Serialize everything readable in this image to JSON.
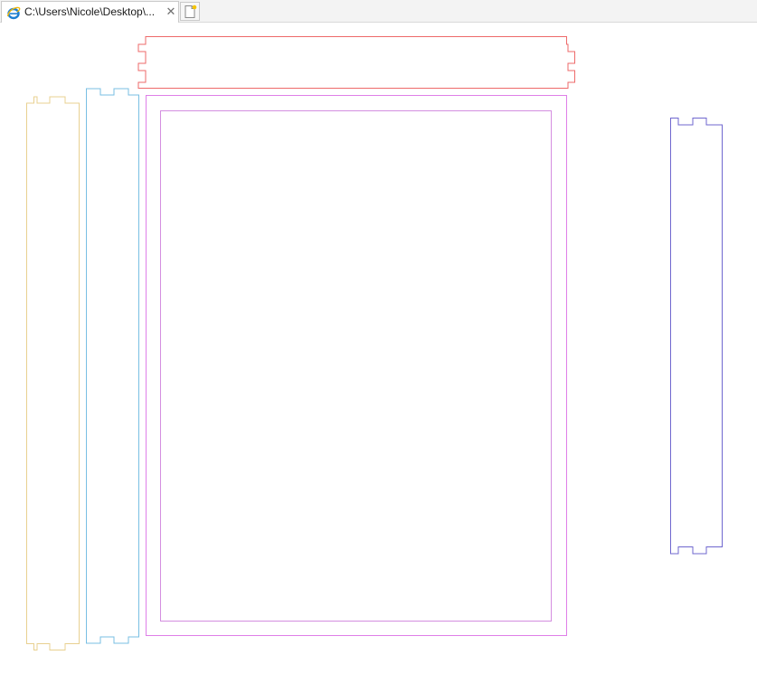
{
  "tab": {
    "title": "C:\\Users\\Nicole\\Desktop\\...",
    "close_glyph": "✕",
    "icon": "internet-explorer-icon"
  },
  "new_tab": {
    "icon": "new-tab-icon"
  },
  "drawing": {
    "colors": {
      "top_piece": "#ee6a6a",
      "left_side_piece": "#e8d090",
      "second_side_piece": "#79bfe3",
      "panel_outer": "#df7fe8",
      "panel_inner": "#d48ee0",
      "right_side_piece": "#6f67cf"
    }
  }
}
